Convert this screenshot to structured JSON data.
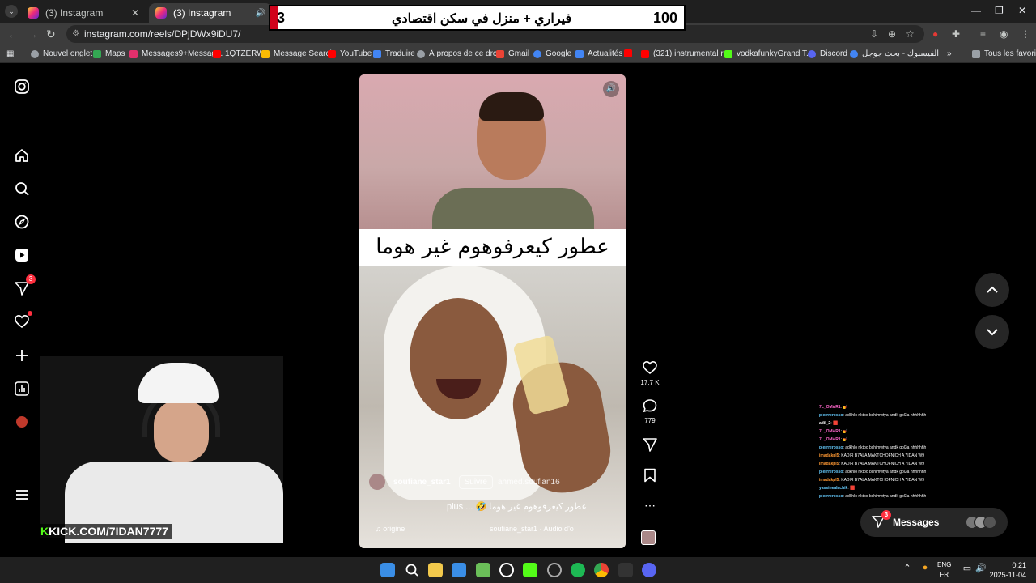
{
  "browser": {
    "tabs": [
      {
        "label": "(3) Instagram"
      },
      {
        "label": "(3) Instagram"
      }
    ],
    "url": "instagram.com/reels/DPjDWx9iDU7/",
    "bookmarks": [
      {
        "label": "Nouvel onglet",
        "color": "#9aa0a6"
      },
      {
        "label": "Maps",
        "color": "#34a853"
      },
      {
        "label": "Messages9+Messag...",
        "color": "#e1306c"
      },
      {
        "label": "1QTZERW",
        "color": "#ff0000"
      },
      {
        "label": "Message Search",
        "color": "#fbbc04"
      },
      {
        "label": "YouTube",
        "color": "#ff0000"
      },
      {
        "label": "Traduire",
        "color": "#4285f4"
      },
      {
        "label": "À propos de ce drop",
        "color": "#9aa0a6"
      },
      {
        "label": "Gmail",
        "color": "#ea4335"
      },
      {
        "label": "Google",
        "color": "#4285f4"
      },
      {
        "label": "Actualités",
        "color": "#4285f4"
      },
      {
        "label": "",
        "color": "#ff0000"
      },
      {
        "label": "(321) instrumental r...",
        "color": "#ff0000"
      },
      {
        "label": "vodkafunkyGrand T...",
        "color": "#53fc18"
      },
      {
        "label": "Discord",
        "color": "#5865f2"
      },
      {
        "label": "الفيسبوك - بحث جوجل",
        "color": "#4285f4"
      }
    ],
    "all_bookmarks": "Tous les favoris"
  },
  "banner": {
    "left_number": "3",
    "title": "فيراري + منزل في سكن اقتصادي",
    "right_number": "100"
  },
  "nav": {
    "messages_badge": "3"
  },
  "reel": {
    "overlay_caption": "عطور كيعرفوهوم غير هوما 🤣",
    "username": "soufiane_star1",
    "follow_label": "Suivre",
    "collab_label": "ahmed.soufian16",
    "caption": "عطور كيعرفوهوم غير هوما 🤣 ... plus",
    "audio_origin": "origine",
    "audio": "soufiane_star1 · Audio d'o",
    "likes": "17,7 K",
    "comments": "779"
  },
  "chat": [
    {
      "name": "7L_OMAR1",
      "text": ": 💅",
      "color": "#ff66cc"
    },
    {
      "name": "pierrrerosso",
      "text": ": adkhlo nktbo bchimwtya andk gol3a hhhhhhh",
      "color": "#66ccff"
    },
    {
      "name": "adil_2",
      "text": ": 🟥",
      "color": "#ffffff"
    },
    {
      "name": "7L_OMAR1",
      "text": ": 💅",
      "color": "#ff66cc"
    },
    {
      "name": "7L_OMAR1",
      "text": ": 💅",
      "color": "#ff66cc"
    },
    {
      "name": "pierrrerosso",
      "text": ": adkhlo nktbo bchimwtya andk gol3a hhhhhhh",
      "color": "#66ccff"
    },
    {
      "name": "imadakpl5",
      "text": ": KADIR B7ALA MAKTCHOFNICH A 7IDAN W9",
      "color": "#ff9933"
    },
    {
      "name": "imadakpl5",
      "text": ": KADIR B7ALA MAKTCHOFNICH A 7IDAN W9",
      "color": "#ff9933"
    },
    {
      "name": "pierrrerosso",
      "text": ": adkhlo nktbo bchimwtya andk gol3a hhhhhhh",
      "color": "#66ccff"
    },
    {
      "name": "imadakpl5",
      "text": ": KADIR B7ALA MAKTCHOFNICH A 7IDAN W9",
      "color": "#ff9933"
    },
    {
      "name": "yassinealachik",
      "text": ": 🟥",
      "color": "#66ccff"
    },
    {
      "name": "pierrrerosso",
      "text": ": adkhlo nktbo bchimwtya andk gol3a hhhhhhh",
      "color": "#66ccff"
    }
  ],
  "messages": {
    "label": "Messages",
    "badge": "3"
  },
  "stream": {
    "kick_k": "K",
    "kick_url": "KICK.COM/7IDAN7777"
  },
  "taskbar": {
    "lang_top": "ENG",
    "lang_bottom": "FR",
    "time": "0:21",
    "date": "2025-11-04"
  }
}
